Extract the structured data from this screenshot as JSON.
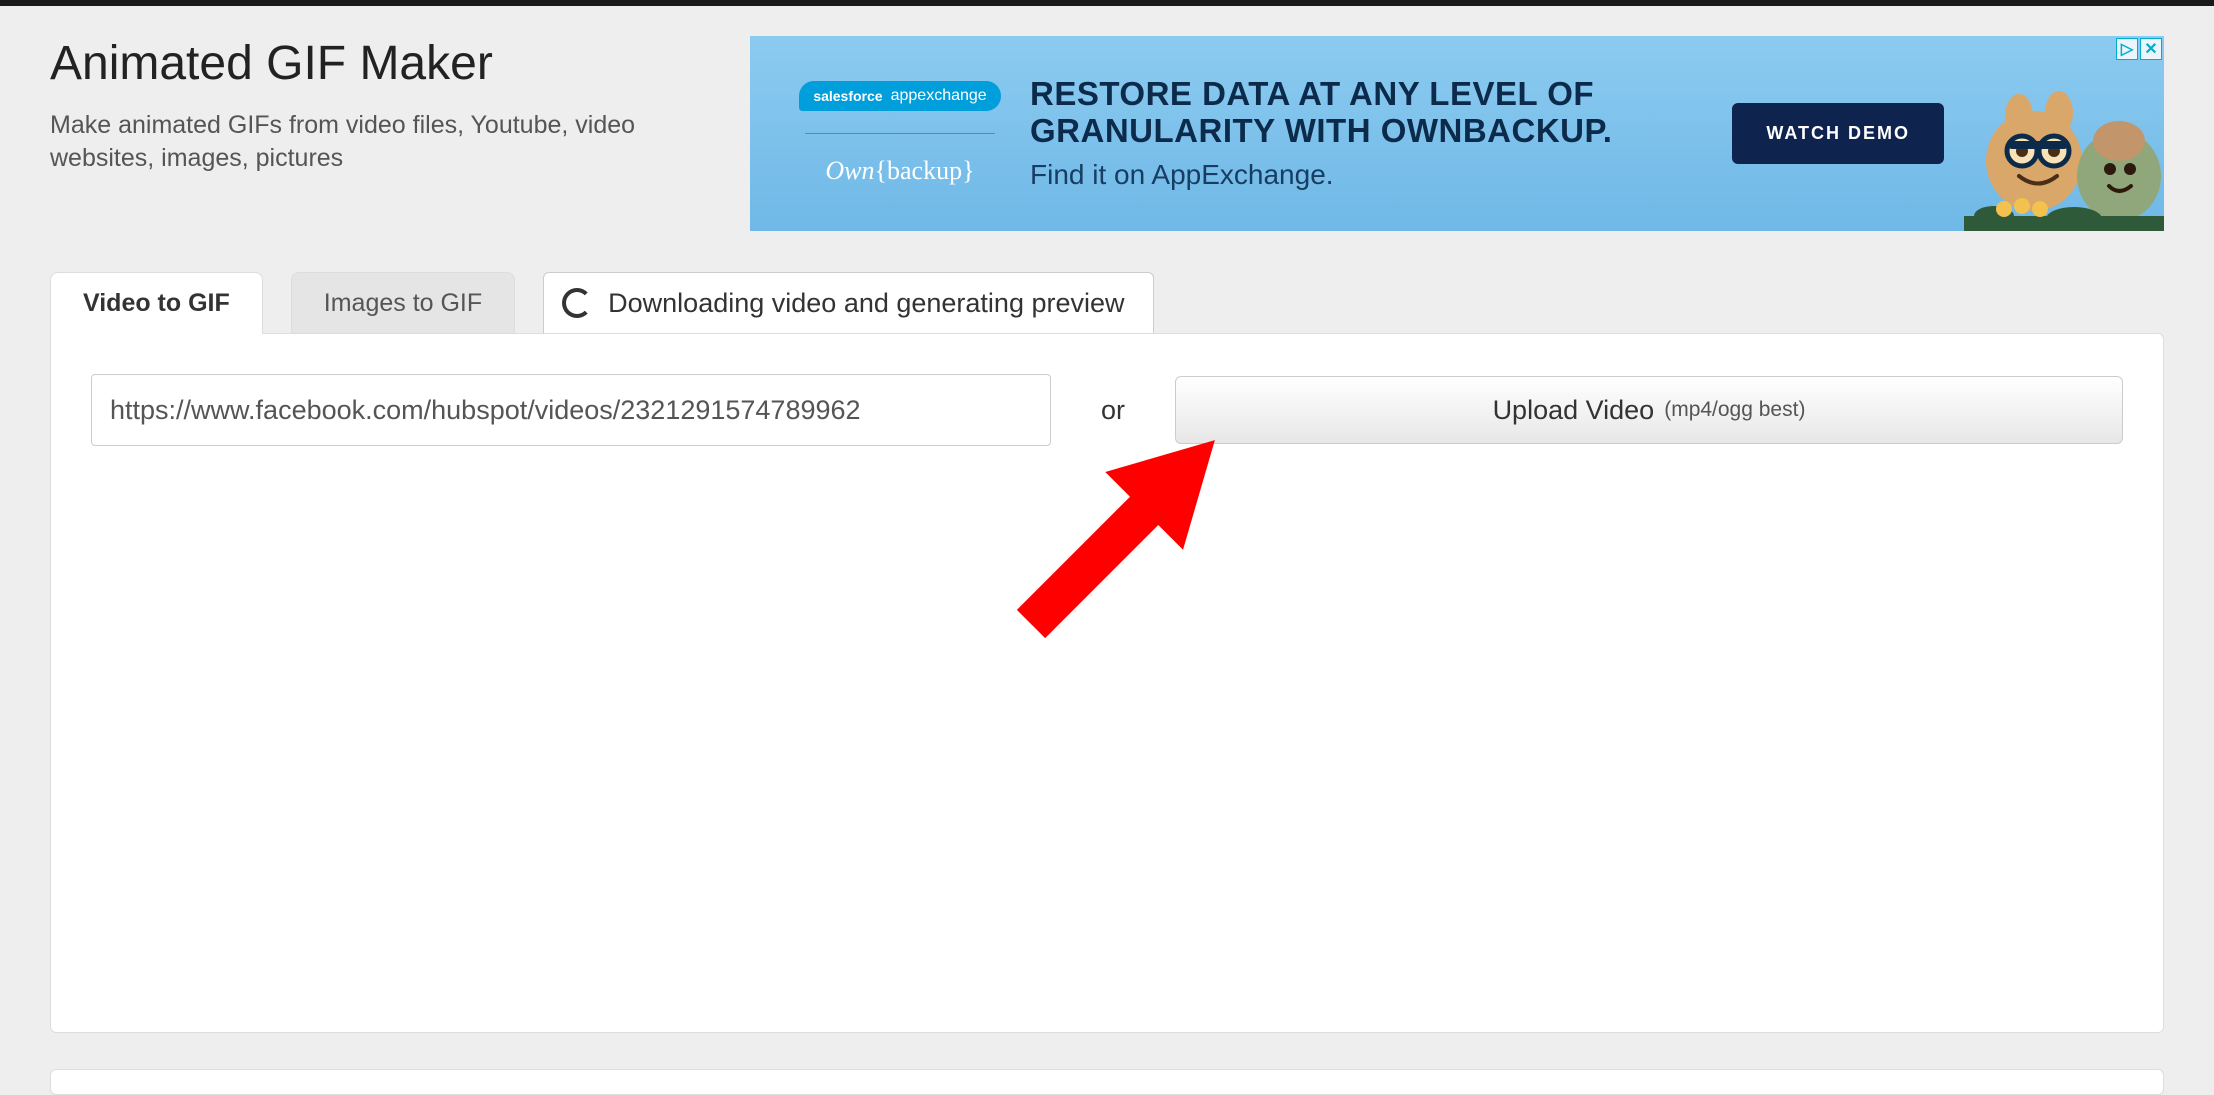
{
  "header": {
    "title": "Animated GIF Maker",
    "subtitle": "Make animated GIFs from video files, Youtube, video websites, images, pictures"
  },
  "ad": {
    "sf_logo": "salesforce",
    "sf_appex": "appexchange",
    "own_backup": "Own{backup}",
    "headline": "RESTORE DATA AT ANY LEVEL OF GRANULARITY WITH OWNBACKUP.",
    "subline": "Find it on AppExchange.",
    "button": "WATCH DEMO",
    "adchoices_icon": "▷",
    "close_icon": "✕"
  },
  "tabs": {
    "video_to_gif": "Video to GIF",
    "images_to_gif": "Images to GIF"
  },
  "status": {
    "text": "Downloading video and generating preview"
  },
  "form": {
    "url_value": "https://www.facebook.com/hubspot/videos/2321291574789962",
    "or": "or",
    "upload_label": "Upload Video",
    "upload_hint": "(mp4/ogg best)"
  }
}
